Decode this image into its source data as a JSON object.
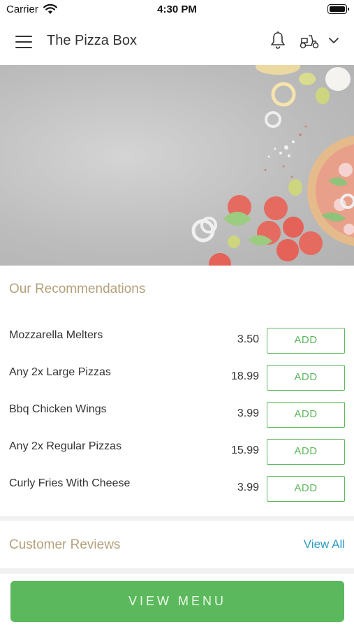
{
  "status_bar": {
    "carrier": "Carrier",
    "time": "4:30 PM"
  },
  "header": {
    "title": "The Pizza Box"
  },
  "recommendations": {
    "title": "Our Recommendations",
    "items": [
      {
        "name": "Mozzarella Melters",
        "price": "3.50",
        "button": "ADD"
      },
      {
        "name": "Any 2x  Large Pizzas",
        "price": "18.99",
        "button": "ADD"
      },
      {
        "name": "Bbq Chicken Wings",
        "price": "3.99",
        "button": "ADD"
      },
      {
        "name": "Any 2x  Regular Pizzas",
        "price": "15.99",
        "button": "ADD"
      },
      {
        "name": "Curly Fries With Cheese",
        "price": "3.99",
        "button": "ADD"
      }
    ]
  },
  "reviews": {
    "title": "Customer Reviews",
    "view_all": "View All"
  },
  "footer": {
    "view_menu": "VIEW MENU"
  },
  "colors": {
    "accent_green": "#5cb85c",
    "section_title": "#b3a07a",
    "link_blue": "#2e9bc4"
  }
}
